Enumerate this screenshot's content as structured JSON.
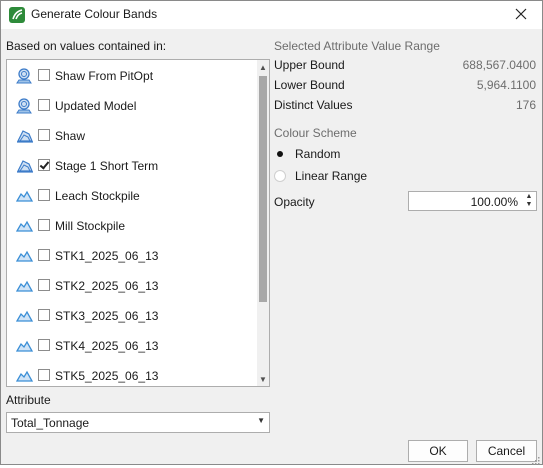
{
  "window": {
    "title": "Generate Colour Bands"
  },
  "left": {
    "based_on_label": "Based on values contained in:",
    "items": [
      {
        "label": "Shaw From PitOpt",
        "checked": false,
        "icon": "pit-model-icon"
      },
      {
        "label": "Updated Model",
        "checked": false,
        "icon": "pit-model-icon"
      },
      {
        "label": "Shaw",
        "checked": false,
        "icon": "pit-shell-icon"
      },
      {
        "label": "Stage 1 Short Term",
        "checked": true,
        "icon": "pit-shell-icon"
      },
      {
        "label": "Leach Stockpile",
        "checked": false,
        "icon": "stockpile-icon"
      },
      {
        "label": "Mill Stockpile",
        "checked": false,
        "icon": "stockpile-icon"
      },
      {
        "label": "STK1_2025_06_13",
        "checked": false,
        "icon": "stockpile-icon"
      },
      {
        "label": "STK2_2025_06_13",
        "checked": false,
        "icon": "stockpile-icon"
      },
      {
        "label": "STK3_2025_06_13",
        "checked": false,
        "icon": "stockpile-icon"
      },
      {
        "label": "STK4_2025_06_13",
        "checked": false,
        "icon": "stockpile-icon"
      },
      {
        "label": "STK5_2025_06_13",
        "checked": false,
        "icon": "stockpile-icon"
      }
    ],
    "attribute_label": "Attribute",
    "attribute_value": "Total_Tonnage"
  },
  "right": {
    "range_title": "Selected Attribute Value Range",
    "upper_bound_label": "Upper Bound",
    "upper_bound_value": "688,567.0400",
    "lower_bound_label": "Lower Bound",
    "lower_bound_value": "5,964.1100",
    "distinct_label": "Distinct Values",
    "distinct_value": "176",
    "scheme_title": "Colour Scheme",
    "scheme_random": "Random",
    "scheme_linear": "Linear Range",
    "selected_scheme": "Random",
    "opacity_label": "Opacity",
    "opacity_value": "100.00%"
  },
  "buttons": {
    "ok": "OK",
    "cancel": "Cancel"
  },
  "colors": {
    "app_icon": "#2e8b3a",
    "model_icon": "#3d7cc9",
    "stockpile_icon": "#3b8fd6",
    "scrollbar_thumb": "#a8a8a8"
  }
}
